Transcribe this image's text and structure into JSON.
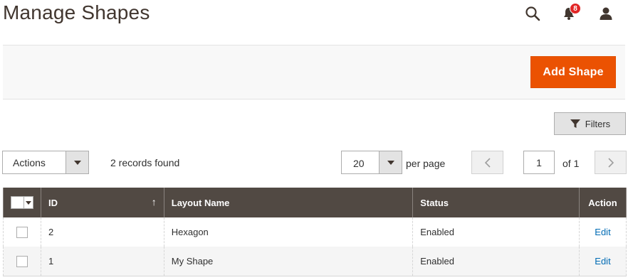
{
  "page": {
    "title": "Manage Shapes"
  },
  "header": {
    "notifications_count": "8",
    "icons": [
      "search-icon",
      "bell-icon",
      "user-icon"
    ]
  },
  "toolbar": {
    "add_label": "Add Shape",
    "filters_label": "Filters"
  },
  "grid_controls": {
    "actions_label": "Actions",
    "records_found": "2 records found",
    "per_page_value": "20",
    "per_page_label": "per page",
    "current_page": "1",
    "page_of": "of 1"
  },
  "grid": {
    "columns": [
      "ID",
      "Layout Name",
      "Status",
      "Action"
    ],
    "rows": [
      {
        "id": "2",
        "name": "Hexagon",
        "status": "Enabled",
        "action": "Edit"
      },
      {
        "id": "1",
        "name": "My Shape",
        "status": "Enabled",
        "action": "Edit"
      }
    ]
  },
  "colors": {
    "accent": "#eb5202",
    "header_bg": "#514943",
    "link": "#006bb4",
    "badge": "#e22626"
  }
}
